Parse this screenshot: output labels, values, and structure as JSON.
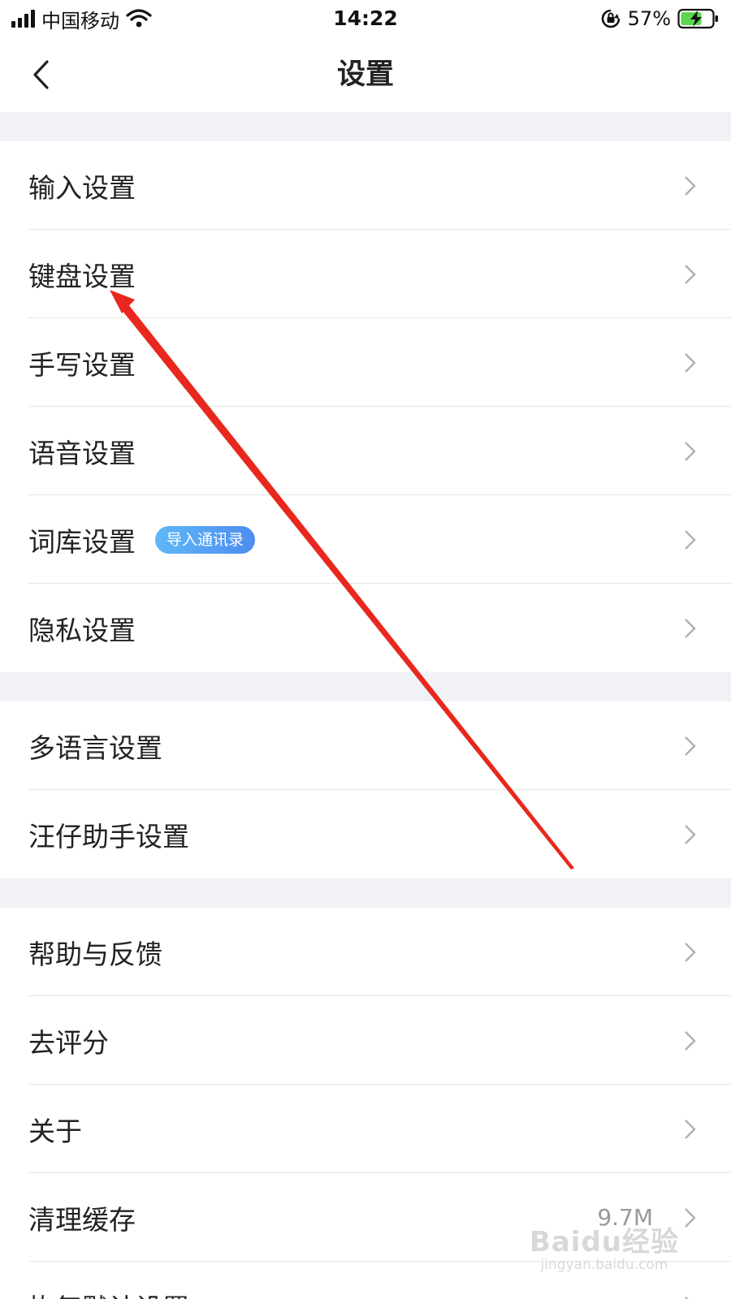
{
  "status_bar": {
    "carrier": "中国移动",
    "time": "14:22",
    "battery_percent": "57%",
    "icons": [
      "signal-icon",
      "wifi-icon",
      "orientation-lock-icon",
      "battery-charging-icon"
    ]
  },
  "nav": {
    "title": "设置",
    "back_icon": "chevron-left-icon"
  },
  "groups": [
    {
      "items": [
        {
          "label": "输入设置"
        },
        {
          "label": "键盘设置"
        },
        {
          "label": "手写设置"
        },
        {
          "label": "语音设置"
        },
        {
          "label": "词库设置",
          "badge": "导入通讯录"
        },
        {
          "label": "隐私设置"
        }
      ]
    },
    {
      "items": [
        {
          "label": "多语言设置"
        },
        {
          "label": "汪仔助手设置"
        }
      ]
    },
    {
      "items": [
        {
          "label": "帮助与反馈"
        },
        {
          "label": "去评分"
        },
        {
          "label": "关于"
        },
        {
          "label": "清理缓存",
          "value": "9.7M"
        },
        {
          "label": "恢复默认设置"
        }
      ]
    }
  ],
  "colors": {
    "background": "#ffffff",
    "group_gap": "#f1f2f6",
    "text": "#222222",
    "secondary_text": "#999999",
    "chevron": "#b0b0b0",
    "badge_start": "#5fb8f6",
    "badge_end": "#4c8cf0",
    "annotation_arrow": "#e8281e"
  },
  "watermark": {
    "logo": "Baidu经验",
    "url": "jingyan.baidu.com"
  }
}
